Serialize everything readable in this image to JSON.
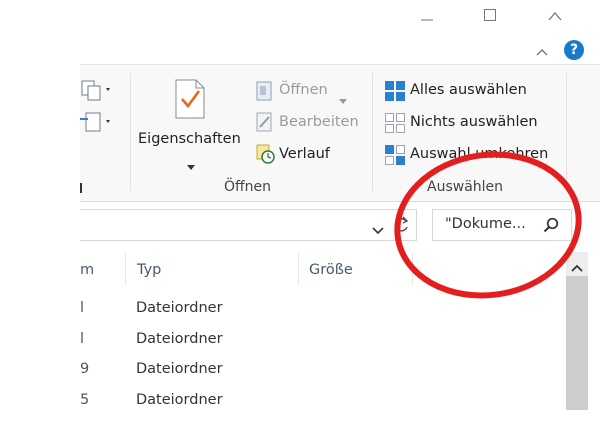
{
  "window": {
    "minimize_icon": "minimize-icon",
    "maximize_icon": "maximize-icon",
    "close_icon": "close-icon"
  },
  "ribbon": {
    "collapse_icon": "chevron-up-icon",
    "help_icon": "help-icon",
    "open_group": {
      "label": "Öffnen",
      "properties_label": "Eigenschaften",
      "open_label": "Öffnen",
      "edit_label": "Bearbeiten",
      "history_label": "Verlauf"
    },
    "select_group": {
      "label": "Auswählen",
      "select_all_label": "Alles auswählen",
      "select_none_label": "Nichts auswählen",
      "invert_selection_label": "Auswahl umkehren"
    }
  },
  "search": {
    "value": "\"Dokume...",
    "icon": "search-icon"
  },
  "columns": {
    "name_partial": "m",
    "type": "Typ",
    "size": "Größe"
  },
  "rows": [
    {
      "date_partial": "l",
      "type": "Dateiordner"
    },
    {
      "date_partial": "l",
      "type": "Dateiordner"
    },
    {
      "date_partial": "9",
      "type": "Dateiordner"
    },
    {
      "date_partial": "5",
      "type": "Dateiordner"
    }
  ],
  "annotation": {
    "color": "#e41e1e"
  },
  "colors": {
    "accent": "#1979ca"
  }
}
